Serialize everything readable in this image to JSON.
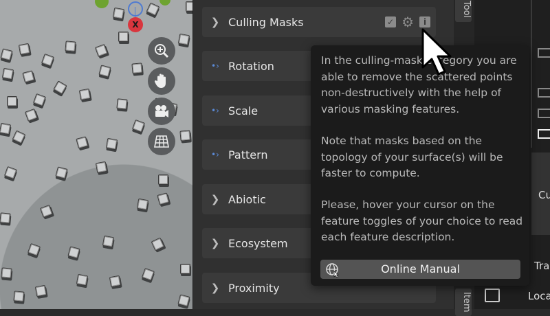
{
  "panel": {
    "rows": [
      {
        "label": "Culling Masks",
        "marker": "chevron"
      },
      {
        "label": "Rotation",
        "marker": "dot"
      },
      {
        "label": "Scale",
        "marker": "dot"
      },
      {
        "label": "Pattern",
        "marker": "dot"
      },
      {
        "label": "Abiotic",
        "marker": "chevron"
      },
      {
        "label": "Ecosystem",
        "marker": "chevron"
      },
      {
        "label": "Proximity",
        "marker": "chevron"
      }
    ]
  },
  "tooltip": {
    "paragraph1": "In the culling-mask category you are able to remove the scattered points non-destructively with the help of various masking features.",
    "paragraph2": "Note that masks based on the topology of your surface(s) will be faster to compute.",
    "paragraph3": "Please, hover your cursor on the feature toggles of your choice to read each feature description.",
    "button_label": "Online Manual"
  },
  "side_tabs": {
    "tool": "Tool",
    "item": "Item"
  },
  "right_panel": {
    "cul_label": "Cul",
    "tra_label": "Tra",
    "loca_label": "Loca"
  },
  "gizmo": {
    "x_axis_label": "X"
  },
  "icons": {
    "zoom": "magnifier-plus-icon",
    "pan": "hand-icon",
    "camera": "camera-icon",
    "grid": "grid-icon",
    "checkbox": "checkbox-icon",
    "gear": "gear-icon",
    "info": "info-icon",
    "globe": "globe-icon",
    "cursor": "mouse-cursor-icon"
  },
  "colors": {
    "accent_dot": "#5b8ad6",
    "gizmo_x": "#d9363e",
    "gizmo_y": "#6ea330",
    "gizmo_z": "#4f7bd1"
  }
}
